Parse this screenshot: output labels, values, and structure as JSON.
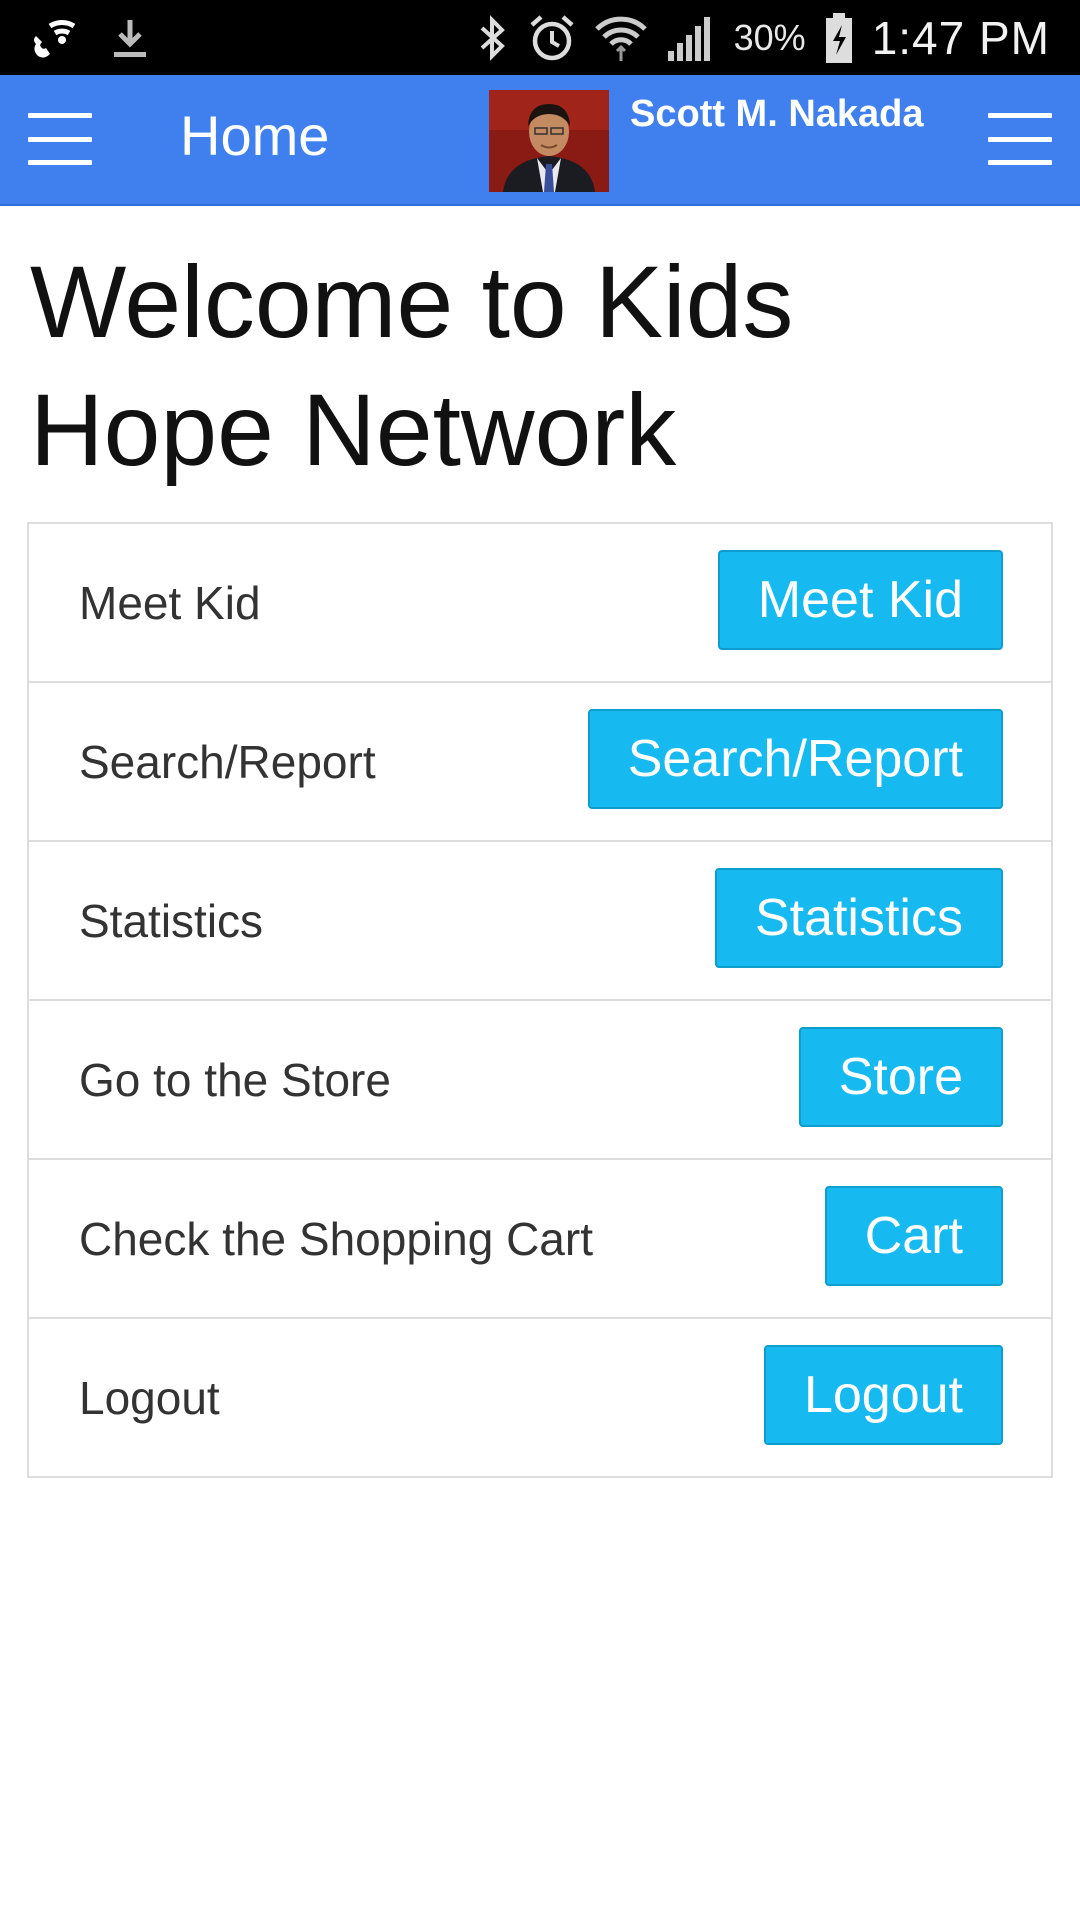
{
  "status_bar": {
    "icons_left": [
      "wifi-call-icon",
      "download-icon"
    ],
    "icons_right": [
      "bluetooth-icon",
      "alarm-icon",
      "wifi-icon",
      "signal-icon",
      "battery-icon"
    ],
    "battery_percent": "30%",
    "time": "1:47 PM"
  },
  "app_bar": {
    "title": "Home",
    "user_name": "Scott M. Nakada",
    "color": "#3f80ee"
  },
  "page": {
    "title": "Welcome to Kids Hope Network"
  },
  "actions": [
    {
      "label": "Meet Kid",
      "button": "Meet Kid"
    },
    {
      "label": "Search/Report",
      "button": "Search/Report"
    },
    {
      "label": "Statistics",
      "button": "Statistics"
    },
    {
      "label": "Go to the Store",
      "button": "Store"
    },
    {
      "label": "Check the Shopping Cart",
      "button": "Cart"
    },
    {
      "label": "Logout",
      "button": "Logout"
    }
  ],
  "colors": {
    "button": "#17baf0",
    "status_bar": "#000000"
  }
}
